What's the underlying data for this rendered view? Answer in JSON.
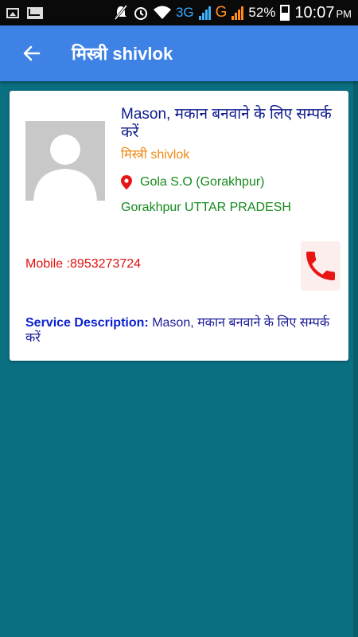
{
  "status_bar": {
    "network_3g": "3G",
    "network_g": "G",
    "battery": "52%",
    "time": "10:07",
    "ampm": "PM"
  },
  "app_bar": {
    "title": "मिस्त्री shivlok"
  },
  "card": {
    "service_title": "Mason, मकान बनवाने के लिए सम्पर्क करें",
    "shop_name": "मिस्त्री shivlok",
    "locality": "Gola S.O (Gorakhpur)",
    "district_state": "Gorakhpur UTTAR PRADESH",
    "mobile": "Mobile :8953273724",
    "description_label": "Service Description:",
    "description_text": "Mason, मकान बनवाने के लिए सम्पर्क करें"
  },
  "colors": {
    "app_bar": "#3f82e6",
    "background": "#0b6f82",
    "title_text": "#0d1a8c",
    "shop_name": "#f08a12",
    "location_text": "#148a1c",
    "mobile_text": "#e01010",
    "call_icon": "#e81515"
  },
  "icons": [
    "image-icon",
    "mail-icon",
    "mute-icon",
    "alarm-icon",
    "wifi-icon",
    "signal-icon",
    "battery-icon",
    "back-arrow-icon",
    "person-placeholder-icon",
    "location-pin-icon",
    "phone-icon"
  ]
}
